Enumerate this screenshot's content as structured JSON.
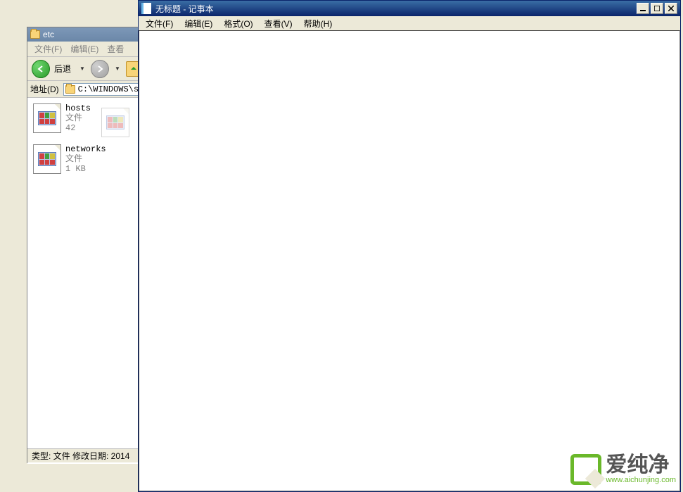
{
  "explorer": {
    "title": "etc",
    "menu": {
      "file": "文件(F)",
      "edit": "编辑(E)",
      "view": "查看"
    },
    "toolbar": {
      "back_label": "后退"
    },
    "address": {
      "label": "地址(D)",
      "path": "C:\\WINDOWS\\s"
    },
    "files": [
      {
        "name": "hosts",
        "type": "文件",
        "size": "42"
      },
      {
        "name": "networks",
        "type": "文件",
        "size": "1 KB"
      }
    ],
    "statusbar": "类型: 文件 修改日期: 2014"
  },
  "notepad": {
    "title": "无标题 - 记事本",
    "menu": {
      "file": "文件(F)",
      "edit": "编辑(E)",
      "format": "格式(O)",
      "view": "查看(V)",
      "help": "帮助(H)"
    },
    "content": ""
  },
  "watermark": {
    "text": "爱纯净",
    "url": "www.aichunjing.com"
  }
}
